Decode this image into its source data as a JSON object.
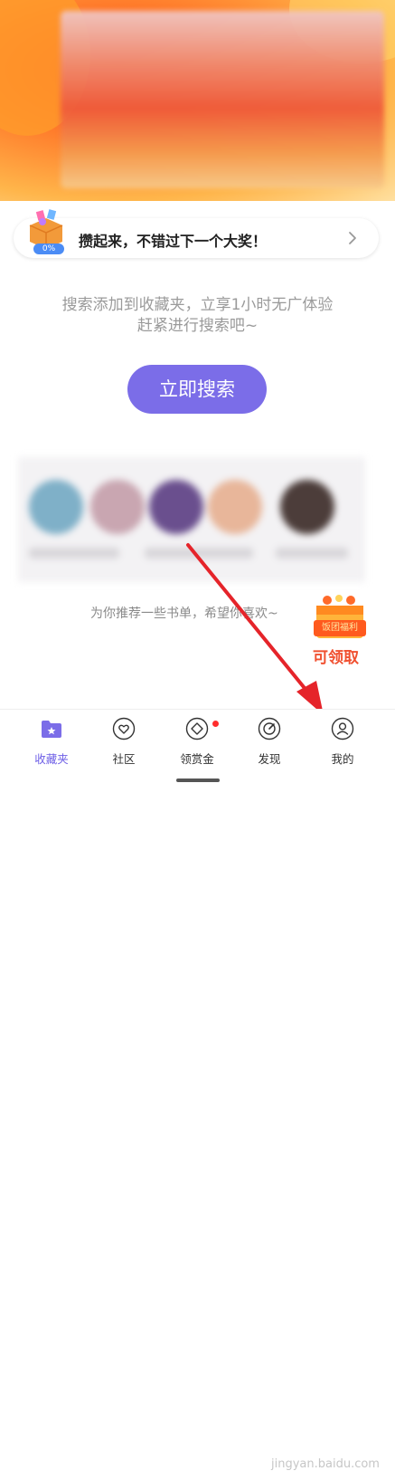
{
  "promo": {
    "text": "攒起来，不错过下一个大奖！",
    "progress": "0%"
  },
  "empty_state": {
    "line1": "搜索添加到收藏夹，立享1小时无广体验",
    "line2": "赶紧进行搜索吧~",
    "search_button": "立即搜索"
  },
  "recommend_text": "为你推荐一些书单，希望你喜欢~",
  "welfare": {
    "tag": "饭团福利",
    "claim": "可领取"
  },
  "tabs": [
    {
      "label": "收藏夹",
      "icon": "folder-star-icon",
      "active": true
    },
    {
      "label": "社区",
      "icon": "heart-icon"
    },
    {
      "label": "领赏金",
      "icon": "diamond-icon",
      "badge": true
    },
    {
      "label": "发现",
      "icon": "compass-icon"
    },
    {
      "label": "我的",
      "icon": "profile-icon"
    }
  ],
  "watermark": "jingyan.baidu.com",
  "colors": {
    "accent": "#7b6de8",
    "tab_active": "#6e5fe6",
    "badge": "#ff2d2d",
    "claim": "#f05030"
  }
}
